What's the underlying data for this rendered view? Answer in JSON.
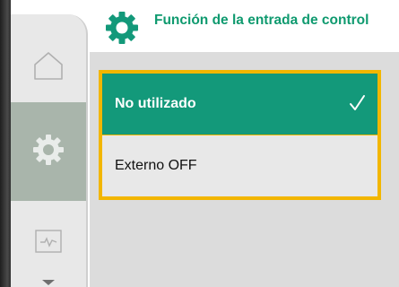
{
  "header": {
    "title": "Función de la entrada de control",
    "icon": "gear-icon",
    "accent_color": "#13997a"
  },
  "sidebar": {
    "items": [
      {
        "name": "home",
        "icon": "home-icon",
        "active": false
      },
      {
        "name": "settings",
        "icon": "gear-icon",
        "active": true
      },
      {
        "name": "diagnostics",
        "icon": "chart-icon",
        "active": false
      },
      {
        "name": "more",
        "icon": "chevron-down-icon",
        "active": false
      }
    ]
  },
  "options": {
    "items": [
      {
        "label": "No utilizado",
        "selected": true,
        "indicator": "check-icon"
      },
      {
        "label": "Externo OFF",
        "selected": false
      }
    ],
    "focus_color": "#f2b600"
  }
}
